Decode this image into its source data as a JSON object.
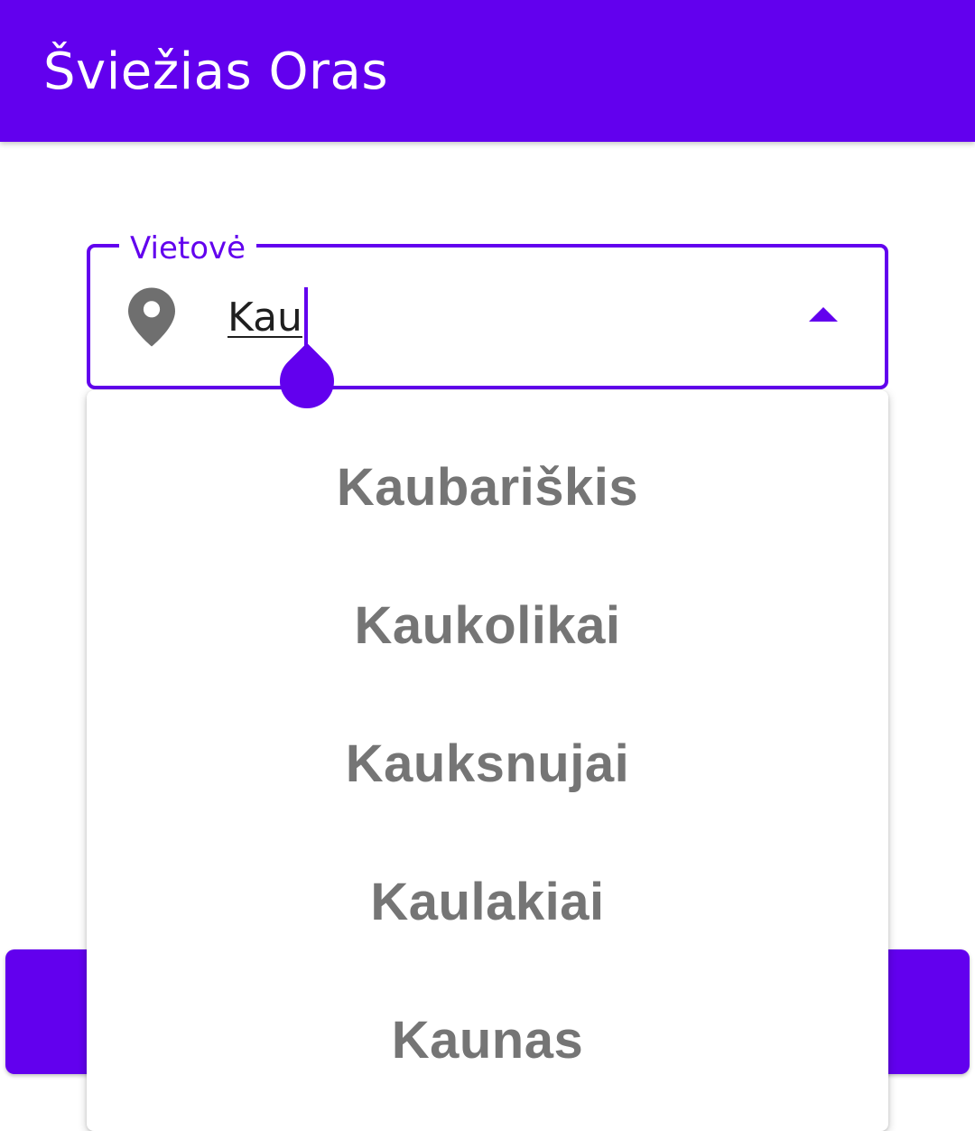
{
  "app_bar": {
    "title": "Šviežias Oras",
    "color": "#6200ee"
  },
  "location_field": {
    "label": "Vietovė",
    "value": "Kau",
    "icon": "location-pin-icon",
    "toggle_icon": "arrow-drop-up-icon",
    "accent_color": "#6200ee"
  },
  "suggestions": [
    {
      "label": "Kaubariškis"
    },
    {
      "label": "Kaukolikai"
    },
    {
      "label": "Kauksnujai"
    },
    {
      "label": "Kaulakiai"
    },
    {
      "label": "Kaunas"
    }
  ]
}
